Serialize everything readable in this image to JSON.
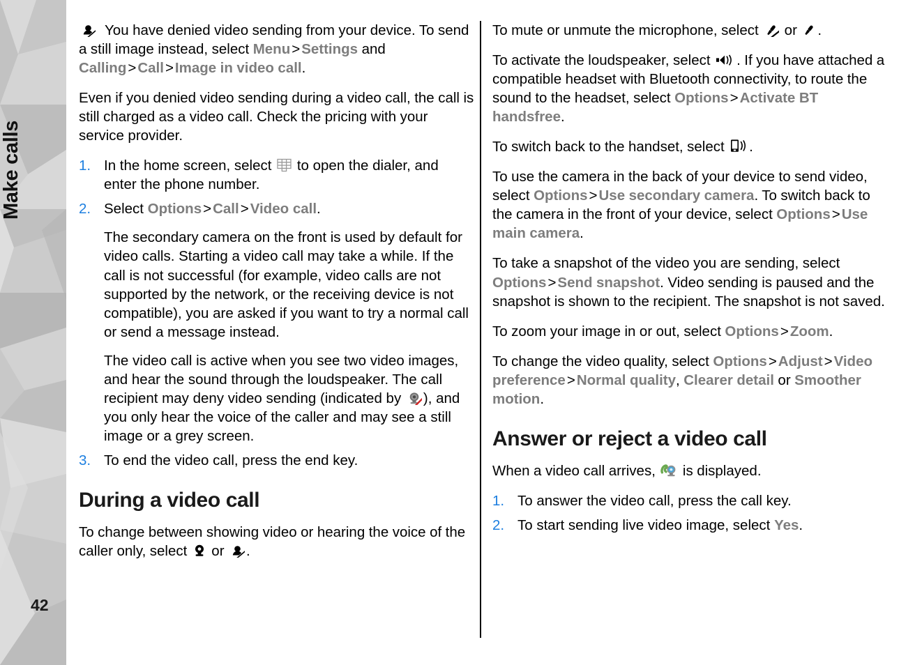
{
  "page": {
    "chapter_title": "Make calls",
    "page_number": "42",
    "accent_blue": "#1d7fe0",
    "ui_grey": "#7d7d7d",
    "sidebar_grey": "#c9c9c9"
  },
  "icons": {
    "video_off": "video-off-icon",
    "dialer_keypad": "dialer-keypad-icon",
    "camera_denied": "camera-denied-icon",
    "webcam": "webcam-icon",
    "video_off_head": "video-off-head-icon",
    "mic_muted": "mic-muted-icon",
    "mic_active": "mic-active-icon",
    "loudspeaker": "loudspeaker-icon",
    "handset_speaker": "handset-speaker-icon",
    "incoming_video_call": "incoming-video-call-icon"
  },
  "left_column": {
    "note_1": {
      "text_a": "You have denied video sending from your device. To send a still image instead, select ",
      "menu": "Menu",
      "sep1": ">",
      "settings": "Settings",
      "and": " and ",
      "calling": "Calling",
      "sep2": ">",
      "call": "Call",
      "sep3": ">",
      "image_in_video_call": "Image in video call",
      "period": "."
    },
    "para_2": "Even if you denied video sending during a video call, the call is still charged as a video call. Check the pricing with your service provider.",
    "steps": {
      "step1_a": "In the home screen, select ",
      "step1_b": " to open the dialer, and enter the phone number.",
      "step2_a": "Select ",
      "step2_options": "Options",
      "step2_sep1": ">",
      "step2_call": "Call",
      "step2_sep2": ">",
      "step2_video_call": "Video call",
      "step2_period": ".",
      "step2_sub1": "The secondary camera on the front is used by default for video calls. Starting a video call may take a while. If the call is not successful (for example, video calls are not supported by the network, or the receiving device is not compatible), you are asked if you want to try a normal call or send a message instead.",
      "step2_sub2_a": "The video call is active when you see two video images, and hear the sound through the loudspeaker. The call recipient may deny video sending (indicated by ",
      "step2_sub2_b": "), and you only hear the voice of the caller and may see a still image or a grey screen.",
      "step3": "To end the video call, press the end key."
    },
    "heading_during": "During a video call",
    "para_during_a": "To change between showing video or hearing the voice of the caller only, select ",
    "para_during_or": " or ",
    "para_during_end": "."
  },
  "right_column": {
    "para_mute_a": "To mute or unmute the microphone, select ",
    "para_mute_or": " or ",
    "para_mute_end": ".",
    "para_loudspeaker_a": "To activate the loudspeaker, select ",
    "para_loudspeaker_b": ". If you have attached a compatible headset with Bluetooth connectivity, to route the sound to the headset, select ",
    "para_loudspeaker_options": "Options",
    "para_loudspeaker_sep": ">",
    "para_loudspeaker_bt": "Activate BT handsfree",
    "para_loudspeaker_period": ".",
    "para_handset_a": "To switch back to the handset, select ",
    "para_handset_end": ".",
    "para_camera_a": "To use the camera in the back of your device to send video, select ",
    "para_camera_options1": "Options",
    "para_camera_sep1": ">",
    "para_camera_secondary": "Use secondary camera",
    "para_camera_b": ". To switch back to the camera in the front of your device, select ",
    "para_camera_options2": "Options",
    "para_camera_sep2": ">",
    "para_camera_main": "Use main camera",
    "para_camera_period": ".",
    "para_snapshot_a": "To take a snapshot of the video you are sending, select ",
    "para_snapshot_options": "Options",
    "para_snapshot_sep": ">",
    "para_snapshot_send": "Send snapshot",
    "para_snapshot_b": ". Video sending is paused and the snapshot is shown to the recipient. The snapshot is not saved.",
    "para_zoom_a": "To zoom your image in or out, select ",
    "para_zoom_options": "Options",
    "para_zoom_sep": ">",
    "para_zoom_zoom": "Zoom",
    "para_zoom_period": ".",
    "para_quality_a": "To change the video quality, select ",
    "para_quality_options": "Options",
    "para_quality_sep1": ">",
    "para_quality_adjust": "Adjust",
    "para_quality_sep2": ">",
    "para_quality_videopref": "Video preference",
    "para_quality_sep3": ">",
    "para_quality_normal": "Normal quality",
    "para_quality_comma": ", ",
    "para_quality_clearer": "Clearer detail",
    "para_quality_or": " or ",
    "para_quality_smoother": "Smoother motion",
    "para_quality_period": ".",
    "heading_answer": "Answer or reject a video call",
    "para_arrives_a": "When a video call arrives, ",
    "para_arrives_b": " is displayed.",
    "step1": "To answer the video call, press the call key.",
    "step2_a": "To start sending live video image, select ",
    "step2_yes": "Yes",
    "step2_period": "."
  }
}
